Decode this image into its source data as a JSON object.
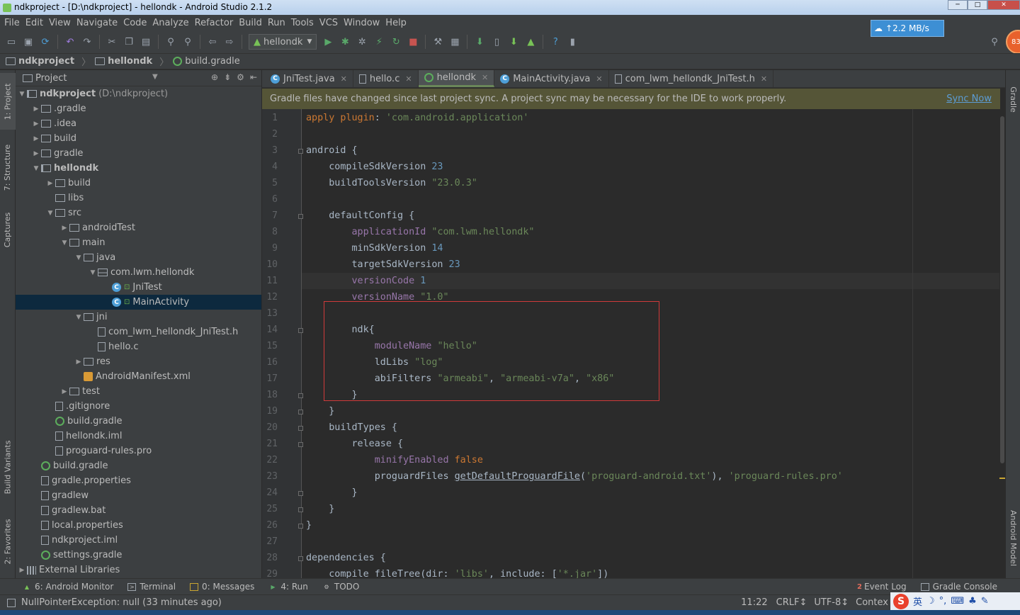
{
  "window": {
    "title": "ndkproject - [D:\\ndkproject] - hellondk - Android Studio 2.1.2"
  },
  "menu": [
    "File",
    "Edit",
    "View",
    "Navigate",
    "Code",
    "Analyze",
    "Refactor",
    "Build",
    "Run",
    "Tools",
    "VCS",
    "Window",
    "Help"
  ],
  "toolbar": {
    "run_config": "hellondk",
    "net_speed": "2.2 MB/s",
    "avatar_badge": "83"
  },
  "breadcrumb": [
    "ndkproject",
    "hellondk",
    "build.gradle"
  ],
  "project_panel": {
    "view_label": "Project",
    "root_label": "ndkproject",
    "root_path": "(D:\\ndkproject)",
    "items": [
      {
        "label": ".gradle",
        "depth": 1,
        "arrow": "right",
        "icon": "folder"
      },
      {
        "label": ".idea",
        "depth": 1,
        "arrow": "right",
        "icon": "folder"
      },
      {
        "label": "build",
        "depth": 1,
        "arrow": "right",
        "icon": "folder"
      },
      {
        "label": "gradle",
        "depth": 1,
        "arrow": "right",
        "icon": "folder"
      },
      {
        "label": "hellondk",
        "depth": 1,
        "arrow": "down",
        "icon": "mod",
        "bold": true
      },
      {
        "label": "build",
        "depth": 2,
        "arrow": "right",
        "icon": "folder"
      },
      {
        "label": "libs",
        "depth": 2,
        "arrow": "",
        "icon": "folder"
      },
      {
        "label": "src",
        "depth": 2,
        "arrow": "down",
        "icon": "folder"
      },
      {
        "label": "androidTest",
        "depth": 3,
        "arrow": "right",
        "icon": "folder"
      },
      {
        "label": "main",
        "depth": 3,
        "arrow": "down",
        "icon": "folder"
      },
      {
        "label": "java",
        "depth": 4,
        "arrow": "down",
        "icon": "folder"
      },
      {
        "label": "com.lwm.hellondk",
        "depth": 5,
        "arrow": "down",
        "icon": "pkg"
      },
      {
        "label": "JniTest",
        "depth": 6,
        "arrow": "",
        "icon": "cls",
        "lock": true
      },
      {
        "label": "MainActivity",
        "depth": 6,
        "arrow": "",
        "icon": "cls",
        "lock": true,
        "selected": true
      },
      {
        "label": "jni",
        "depth": 4,
        "arrow": "down",
        "icon": "folder"
      },
      {
        "label": "com_lwm_hellondk_JniTest.h",
        "depth": 5,
        "arrow": "",
        "icon": "file"
      },
      {
        "label": "hello.c",
        "depth": 5,
        "arrow": "",
        "icon": "file"
      },
      {
        "label": "res",
        "depth": 4,
        "arrow": "right",
        "icon": "folder"
      },
      {
        "label": "AndroidManifest.xml",
        "depth": 4,
        "arrow": "",
        "icon": "xml"
      },
      {
        "label": "test",
        "depth": 3,
        "arrow": "right",
        "icon": "folder"
      },
      {
        "label": ".gitignore",
        "depth": 2,
        "arrow": "",
        "icon": "file"
      },
      {
        "label": "build.gradle",
        "depth": 2,
        "arrow": "",
        "icon": "gradle"
      },
      {
        "label": "hellondk.iml",
        "depth": 2,
        "arrow": "",
        "icon": "file"
      },
      {
        "label": "proguard-rules.pro",
        "depth": 2,
        "arrow": "",
        "icon": "file"
      },
      {
        "label": "build.gradle",
        "depth": 1,
        "arrow": "",
        "icon": "gradle"
      },
      {
        "label": "gradle.properties",
        "depth": 1,
        "arrow": "",
        "icon": "file"
      },
      {
        "label": "gradlew",
        "depth": 1,
        "arrow": "",
        "icon": "file"
      },
      {
        "label": "gradlew.bat",
        "depth": 1,
        "arrow": "",
        "icon": "file"
      },
      {
        "label": "local.properties",
        "depth": 1,
        "arrow": "",
        "icon": "file"
      },
      {
        "label": "ndkproject.iml",
        "depth": 1,
        "arrow": "",
        "icon": "file"
      },
      {
        "label": "settings.gradle",
        "depth": 1,
        "arrow": "",
        "icon": "gradle"
      },
      {
        "label": "External Libraries",
        "depth": 0,
        "arrow": "right",
        "icon": "ext"
      }
    ]
  },
  "left_tool_tabs": [
    "1: Project",
    "7: Structure",
    "Captures",
    "Build Variants",
    "2: Favorites"
  ],
  "right_tool_tabs": [
    "Gradle",
    "Android Model"
  ],
  "tabs": [
    {
      "label": "JniTest.java",
      "icon": "cls"
    },
    {
      "label": "hello.c",
      "icon": "file"
    },
    {
      "label": "hellondk",
      "icon": "gradle",
      "active": true
    },
    {
      "label": "MainActivity.java",
      "icon": "cls"
    },
    {
      "label": "com_lwm_hellondk_JniTest.h",
      "icon": "file"
    }
  ],
  "banner": {
    "message": "Gradle files have changed since last project sync. A project sync may be necessary for the IDE to work properly.",
    "action": "Sync Now"
  },
  "code_lines": [
    "apply plugin: 'com.android.application'",
    "",
    "android {",
    "    compileSdkVersion 23",
    "    buildToolsVersion \"23.0.3\"",
    "",
    "    defaultConfig {",
    "        applicationId \"com.lwm.hellondk\"",
    "        minSdkVersion 14",
    "        targetSdkVersion 23",
    "        versionCode 1",
    "        versionName \"1.0\"",
    "",
    "        ndk{",
    "            moduleName \"hello\"",
    "            ldLibs \"log\"",
    "            abiFilters \"armeabi\", \"armeabi-v7a\", \"x86\"",
    "        }",
    "    }",
    "    buildTypes {",
    "        release {",
    "            minifyEnabled false",
    "            proguardFiles getDefaultProguardFile('proguard-android.txt'), 'proguard-rules.pro'",
    "        }",
    "    }",
    "}",
    "",
    "dependencies {",
    "    compile fileTree(dir: 'libs', include: ['*.jar'])"
  ],
  "bottom_tools": [
    {
      "label": "6: Android Monitor",
      "icon": "android-icon"
    },
    {
      "label": "Terminal",
      "icon": "terminal-icon"
    },
    {
      "label": "0: Messages",
      "icon": "messages-icon"
    },
    {
      "label": "4: Run",
      "icon": "run-icon"
    },
    {
      "label": "TODO",
      "icon": "todo-icon"
    }
  ],
  "bottom_right_tools": [
    {
      "label": "Event Log",
      "badge": "2"
    },
    {
      "label": "Gradle Console"
    }
  ],
  "status": {
    "message": "NullPointerException: null (33 minutes ago)",
    "position": "11:22",
    "line_sep": "CRLF↕",
    "encoding": "UTF-8↕",
    "context": "Contex"
  },
  "ime": {
    "lang": "英"
  },
  "colors": {
    "keyword": "#cc7832",
    "string": "#6a8759",
    "number": "#6897bb",
    "property": "#9876aa",
    "accent": "#c9a532"
  }
}
